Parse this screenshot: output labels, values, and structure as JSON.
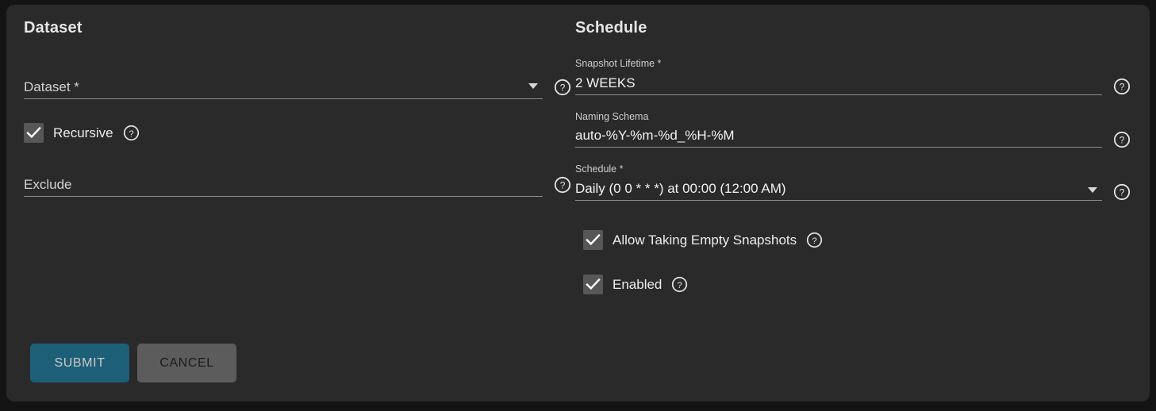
{
  "theme": {
    "page_background": "#141414",
    "card_background": "#2a2a2a",
    "accent": "#1e5f78",
    "cancel_background": "#5c5c5c",
    "underline": "#8e8e8e",
    "checkbox_fill": "#575757"
  },
  "dataset_section": {
    "title": "Dataset",
    "dataset_field": {
      "placeholder": "Dataset *",
      "value": "",
      "dropdown_icon": "chevron-down-icon",
      "help_icon": "help-circle-icon"
    },
    "recursive_checkbox": {
      "label": "Recursive",
      "checked": true,
      "help_icon": "help-circle-icon"
    },
    "exclude_field": {
      "placeholder": "Exclude",
      "value": "",
      "help_icon": "help-circle-icon"
    }
  },
  "schedule_section": {
    "title": "Schedule",
    "snapshot_lifetime": {
      "label": "Snapshot Lifetime *",
      "value": "2 WEEKS",
      "help_icon": "help-circle-icon"
    },
    "naming_schema": {
      "label": "Naming Schema",
      "value": "auto-%Y-%m-%d_%H-%M",
      "help_icon": "help-circle-icon"
    },
    "schedule_select": {
      "label": "Schedule *",
      "value": "Daily (0 0 * * *) at 00:00 (12:00 AM)",
      "dropdown_icon": "chevron-down-icon",
      "help_icon": "help-circle-icon"
    },
    "allow_empty_checkbox": {
      "label": "Allow Taking Empty Snapshots",
      "checked": true,
      "help_icon": "help-circle-icon"
    },
    "enabled_checkbox": {
      "label": "Enabled",
      "checked": true,
      "help_icon": "help-circle-icon"
    }
  },
  "actions": {
    "submit_label": "SUBMIT",
    "cancel_label": "CANCEL"
  }
}
